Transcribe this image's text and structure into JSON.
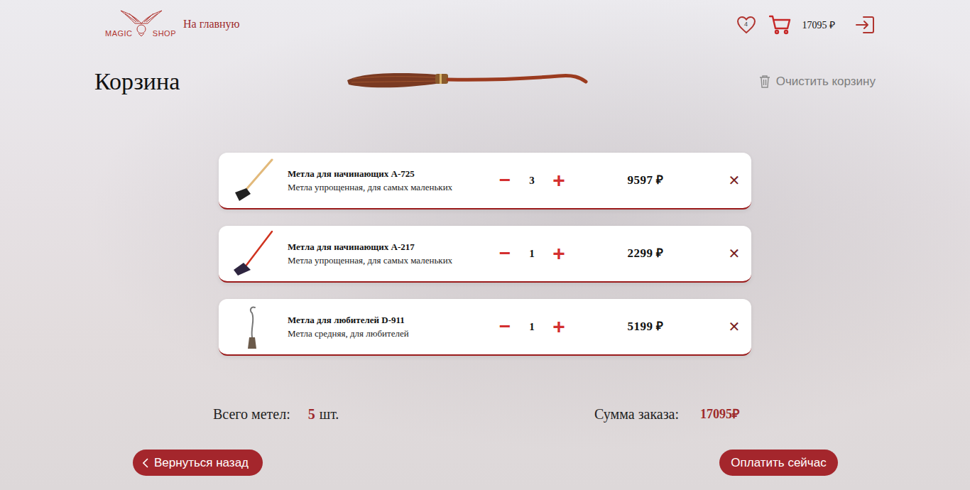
{
  "header": {
    "logo_left": "MAGIC",
    "logo_right": "SHOP",
    "nav_link": "На главную",
    "favorites_count": "4",
    "cart_total": "17095 ₽"
  },
  "page": {
    "title": "Корзина",
    "clear": "Очистить корзину"
  },
  "items": [
    {
      "name": "Метла для начинающих А-725",
      "description": "Метла упрощенная, для самых маленьких",
      "minus": "−",
      "quantity": "3",
      "plus": "+",
      "price": "9597 ₽",
      "remove": "✕"
    },
    {
      "name": "Метла для начинающих А-217",
      "description": "Метла упрощенная, для самых маленьких",
      "minus": "−",
      "quantity": "1",
      "plus": "+",
      "price": "2299 ₽",
      "remove": "✕"
    },
    {
      "name": "Метла для любителей D-911",
      "description": "Метла средняя, для любителей",
      "minus": "−",
      "quantity": "1",
      "plus": "+",
      "price": "5199 ₽",
      "remove": "✕"
    }
  ],
  "summary": {
    "count_label": "Всего метел:",
    "count_value": "5",
    "count_unit": "шт.",
    "sum_label": "Сумма заказа:",
    "sum_value": "17095₽"
  },
  "buttons": {
    "back": "Вернуться назад",
    "pay": "Оплатить сейчас"
  }
}
